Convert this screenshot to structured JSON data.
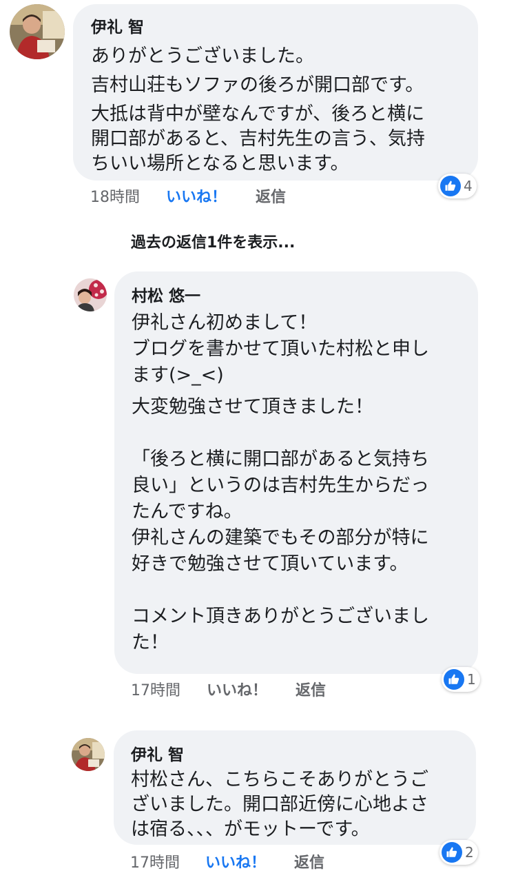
{
  "comments": [
    {
      "author": "伊礼 智",
      "paragraphs": [
        "ありがとうございました。",
        "吉村山荘もソファの後ろが開口部です。",
        "大抵は背中が壁なんですが、後ろと横に\n開口部があると、吉村先生の言う、気持\nちいい場所となると思います。"
      ],
      "time": "18時間",
      "like_label": "いいね！",
      "reply_label": "返信",
      "reaction_count": "4",
      "liked": true
    },
    {
      "author": "村松 悠一",
      "paragraphs": [
        "伊礼さん初めまして！\nブログを書かせて頂いた村松と申し\nます(>_<)",
        "大変勉強させて頂きました！\n\n「後ろと横に開口部があると気持ち\n良い」というのは吉村先生からだっ\nたんですね。\n伊礼さんの建築でもその部分が特に\n好きで勉強させて頂いています。\n\nコメント頂きありがとうございまし\nた！"
      ],
      "time": "17時間",
      "like_label": "いいね！",
      "reply_label": "返信",
      "reaction_count": "1",
      "liked": false
    },
    {
      "author": "伊礼 智",
      "paragraphs": [
        "村松さん、こちらこそありがとうご\nざいました。開口部近傍に心地よさ\nは宿る、、、がモットーです。"
      ],
      "time": "17時間",
      "like_label": "いいね！",
      "reply_label": "返信",
      "reaction_count": "2",
      "liked": true
    }
  ],
  "view_previous_replies": "過去の返信1件を表示...",
  "colors": {
    "accent": "#1877f2",
    "bubble": "#f0f2f5",
    "meta": "#65676b"
  },
  "icons": {
    "reaction": "thumbs-up-icon"
  }
}
